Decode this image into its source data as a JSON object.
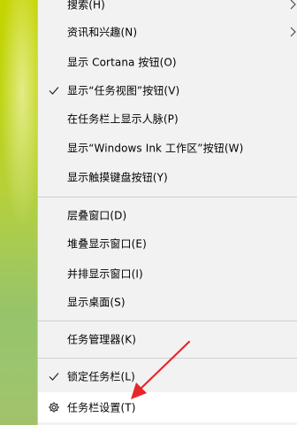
{
  "menu": {
    "items": [
      {
        "label": "搜索(H)"
      },
      {
        "label": "资讯和兴趣(N)"
      },
      {
        "label": "显示 Cortana 按钮(O)"
      },
      {
        "label": "显示“任务视图”按钮(V)"
      },
      {
        "label": "在任务栏上显示人脉(P)"
      },
      {
        "label": "显示“Windows Ink 工作区”按钮(W)"
      },
      {
        "label": "显示触摸键盘按钮(Y)"
      },
      {
        "label": "层叠窗口(D)"
      },
      {
        "label": "堆叠显示窗口(E)"
      },
      {
        "label": "并排显示窗口(I)"
      },
      {
        "label": "显示桌面(S)"
      },
      {
        "label": "任务管理器(K)"
      },
      {
        "label": "锁定任务栏(L)"
      },
      {
        "label": "任务栏设置(T)"
      }
    ],
    "checked": [
      "显示“任务视图”按钮(V)",
      "锁定任务栏(L)"
    ],
    "submenu": [
      "搜索(H)",
      "资讯和兴趣(N)"
    ],
    "highlighted": "任务栏设置(T)"
  },
  "icons": {
    "check": "checkmark-icon",
    "submenu": "chevron-right-icon",
    "settings": "gear-icon"
  },
  "colors": {
    "menu_background": "#f2f2f2",
    "hover_background": "#ffffff",
    "separator": "#cfcfcf",
    "annotation_arrow": "#e8262a",
    "desktop_green": "#b6d03a"
  }
}
